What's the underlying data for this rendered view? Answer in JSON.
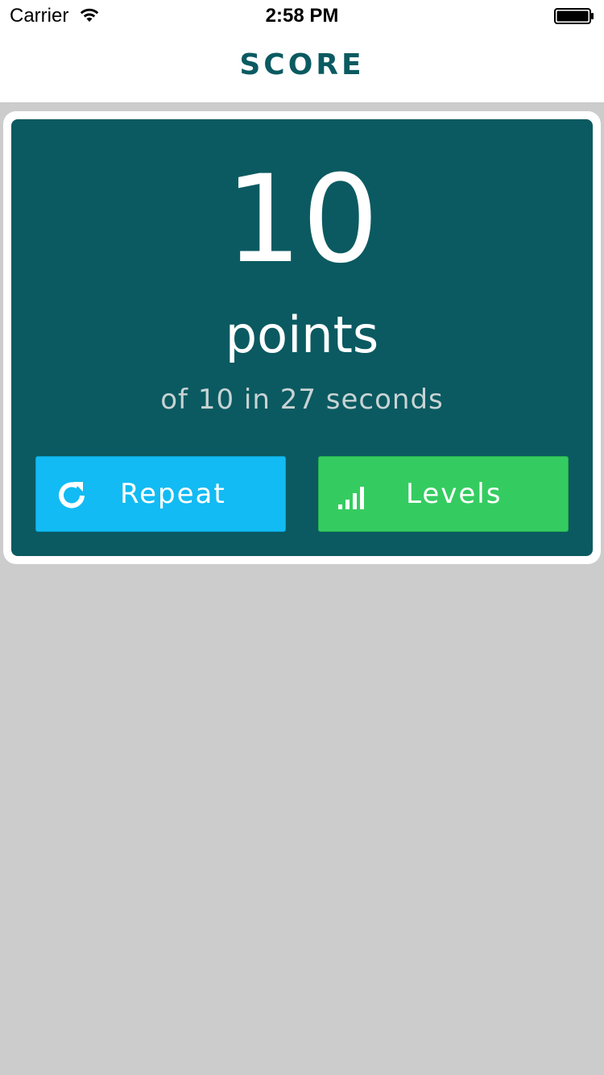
{
  "status_bar": {
    "carrier": "Carrier",
    "time": "2:58 PM",
    "wifi_icon": "wifi-icon",
    "battery_icon": "battery-icon"
  },
  "nav": {
    "title": "SCORE"
  },
  "score": {
    "value": "10",
    "unit": "points",
    "detail": "of 10 in 27 seconds"
  },
  "buttons": {
    "repeat": {
      "label": "Repeat",
      "icon": "refresh-icon",
      "color": "#12bbf3"
    },
    "levels": {
      "label": "Levels",
      "icon": "signal-bars-icon",
      "color": "#34cc60"
    }
  },
  "colors": {
    "card": "#0b5a61",
    "background": "#cccccc",
    "title": "#0b5a61"
  }
}
